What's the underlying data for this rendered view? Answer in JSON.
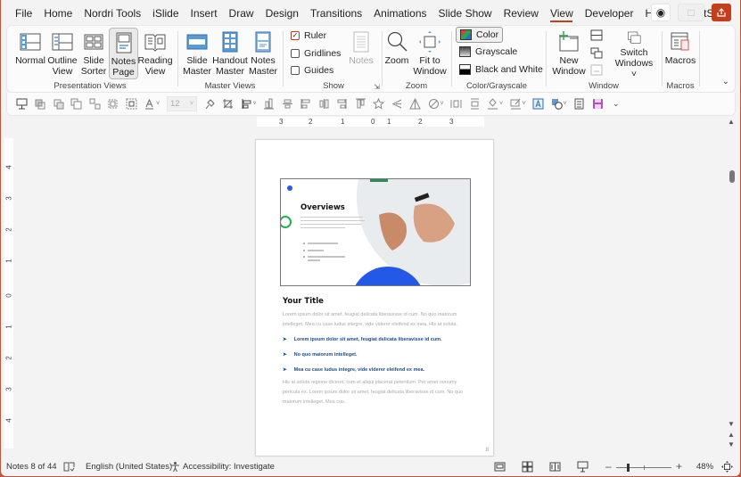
{
  "tabs": [
    "File",
    "Home",
    "Nordri Tools",
    "iSlide",
    "Insert",
    "Draw",
    "Design",
    "Transitions",
    "Animations",
    "Slide Show",
    "Review",
    "View",
    "Developer",
    "Help",
    "BrightSlide"
  ],
  "active_tab": "View",
  "ribbon": {
    "presentation_views": {
      "label": "Presentation Views",
      "buttons": [
        {
          "line1": "Normal",
          "line2": ""
        },
        {
          "line1": "Outline",
          "line2": "View"
        },
        {
          "line1": "Slide",
          "line2": "Sorter"
        },
        {
          "line1": "Notes",
          "line2": "Page"
        },
        {
          "line1": "Reading",
          "line2": "View"
        }
      ],
      "selected": "Notes Page"
    },
    "master_views": {
      "label": "Master Views",
      "buttons": [
        {
          "line1": "Slide",
          "line2": "Master"
        },
        {
          "line1": "Handout",
          "line2": "Master"
        },
        {
          "line1": "Notes",
          "line2": "Master"
        }
      ]
    },
    "show": {
      "label": "Show",
      "ruler": {
        "label": "Ruler",
        "checked": true
      },
      "gridlines": {
        "label": "Gridlines",
        "checked": false
      },
      "guides": {
        "label": "Guides",
        "checked": false
      },
      "notes_label": "Notes"
    },
    "zoom": {
      "label": "Zoom",
      "zoom_btn": "Zoom",
      "fit_line1": "Fit to",
      "fit_line2": "Window"
    },
    "color_grayscale": {
      "label": "Color/Grayscale",
      "items": [
        "Color",
        "Grayscale",
        "Black and White"
      ],
      "selected": "Color"
    },
    "window": {
      "label": "Window",
      "new_line1": "New",
      "new_line2": "Window",
      "switch_line1": "Switch",
      "switch_line2": "Windows ˅"
    },
    "macros": {
      "label": "Macros",
      "button": "Macros"
    }
  },
  "qat": {
    "font_size": "12"
  },
  "ruler": {
    "h_labels": [
      "3",
      "2",
      "1",
      "0",
      "1",
      "2",
      "3"
    ],
    "v_labels": [
      "4",
      "3",
      "2",
      "1",
      "0",
      "1",
      "2",
      "3",
      "4"
    ]
  },
  "page": {
    "slide": {
      "title": "Overviews",
      "bullets": [
        "Lorem ipsum dolor sit amet",
        "Sed vestibulum",
        "Nam quis nulla, sed vulputate libero"
      ]
    },
    "notes_title": "Your Title",
    "para1": "Lorem ipsum dolor sit amet, feugiat delicata liberavisse id cum. No quo maiorum intelleget. Mea cu case ludus integre, vide viderer eleifend ex mea. His at soluta.",
    "bullets": [
      "Lorem ipsum dolor sit amet, feugiat delicata liberavisse id cum.",
      "No quo maiorum intelleget.",
      "Mea cu case ludus integre, vide viderer eleifend ex mea."
    ],
    "para2": "His at soluta regione diceret, cum et aliqui placerat petentium. Per amet nonumy pericula ex. Lorem ipsum dolor sit amet, feugiat delicata liberavisse id cum. No quo maiorum intelleget. Mea cus.",
    "page_number": "8"
  },
  "status": {
    "notes": "Notes 8 of 44",
    "language": "English (United States)",
    "accessibility": "Accessibility: Investigate",
    "zoom": "48%",
    "zoom_percent": 48
  },
  "colors": {
    "accent": "#c43e1c",
    "slide_blue": "#2459e8",
    "slide_green": "#22b14c",
    "notes_bullet": "#1a4d8a"
  }
}
